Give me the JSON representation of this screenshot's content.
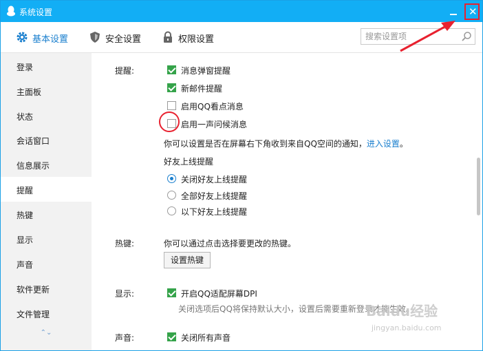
{
  "window": {
    "title": "系统设置",
    "close_glyph": "✕"
  },
  "tabs": [
    {
      "label": "基本设置",
      "icon": "gear-icon",
      "active": true
    },
    {
      "label": "安全设置",
      "icon": "shield-icon",
      "active": false
    },
    {
      "label": "权限设置",
      "icon": "lock-icon",
      "active": false
    }
  ],
  "search": {
    "placeholder": "搜索设置项",
    "value": ""
  },
  "sidebar": {
    "items": [
      "登录",
      "主面板",
      "状态",
      "会话窗口",
      "信息展示",
      "提醒",
      "热键",
      "显示",
      "声音",
      "软件更新",
      "文件管理"
    ],
    "active_index": 5,
    "scroll_arrows": "⌃⌄"
  },
  "reminders": {
    "label": "提醒:",
    "options": [
      {
        "label": "消息弹窗提醒",
        "checked": true
      },
      {
        "label": "新邮件提醒",
        "checked": true
      },
      {
        "label": "启用QQ看点消息",
        "checked": false
      },
      {
        "label": "启用一声问候消息",
        "checked": false
      }
    ],
    "note": "你可以设置是否在屏幕右下角收到来自QQ空间的通知，",
    "note_link": "进入设置",
    "note_end": "。",
    "friend_online_title": "好友上线提醒",
    "friend_online_options": [
      {
        "label": "关闭好友上线提醒",
        "selected": true
      },
      {
        "label": "全部好友上线提醒",
        "selected": false
      },
      {
        "label": "以下好友上线提醒",
        "selected": false
      }
    ]
  },
  "hotkeys": {
    "label": "热键:",
    "note": "你可以通过点击选择要更改的热键。",
    "button": "设置热键"
  },
  "display": {
    "label": "显示:",
    "option": {
      "label": "开启QQ适配屏幕DPI",
      "checked": true
    },
    "note": "关闭选项后QQ将保持默认大小，设置后需要重新登录才能生效。"
  },
  "sound": {
    "label": "声音:",
    "option": {
      "label": "关闭所有声音",
      "checked": true
    }
  },
  "watermark": {
    "text": "Baidu经验",
    "sub": "jingyan.baidu.com"
  },
  "colors": {
    "titlebar": "#12aef5",
    "accent": "#1a7fce",
    "check_green": "#35a34a",
    "highlight_red": "#e8212f"
  }
}
